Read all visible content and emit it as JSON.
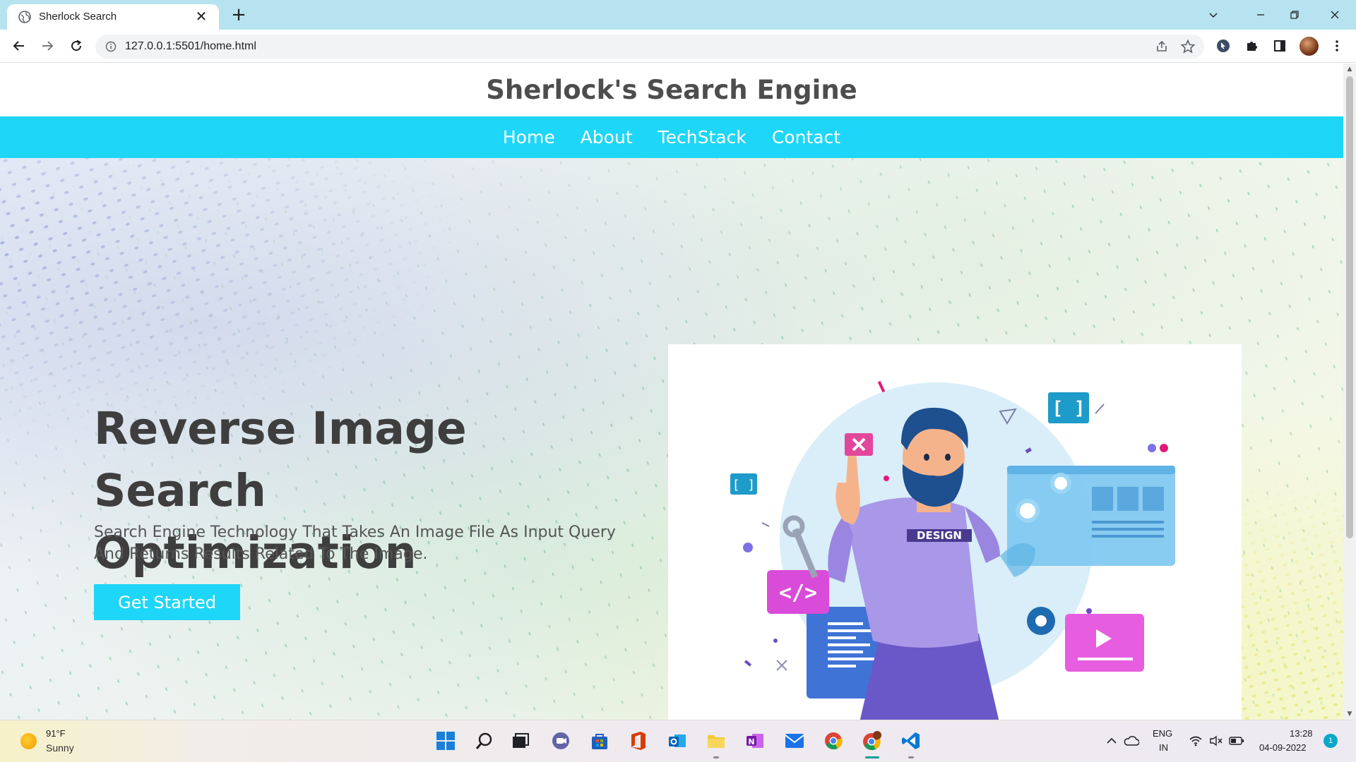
{
  "browser": {
    "tab_title": "Sherlock Search",
    "tab_close": "✕",
    "new_tab": "+",
    "url": "127.0.0.1:5501/home.html"
  },
  "site": {
    "title": "Sherlock's Search Engine",
    "nav": [
      {
        "label": "Home"
      },
      {
        "label": "About"
      },
      {
        "label": "TechStack"
      },
      {
        "label": "Contact"
      }
    ],
    "hero": {
      "heading_line1": "Reverse Image Search",
      "heading_line2": "Optimization",
      "subtitle": "Search Engine Technology That Takes An Image File As Input Query And Returns Results Related To The Image.",
      "cta_label": "Get Started"
    },
    "illustration": {
      "shirt_text": "DESIGN"
    },
    "colors": {
      "accent": "#1ed6f7",
      "heading": "#3e3e3e"
    }
  },
  "taskbar": {
    "weather_temp": "91°F",
    "weather_desc": "Sunny",
    "lang_line1": "ENG",
    "lang_line2": "IN",
    "time": "13:28",
    "date": "04-09-2022",
    "notifications": "1"
  }
}
